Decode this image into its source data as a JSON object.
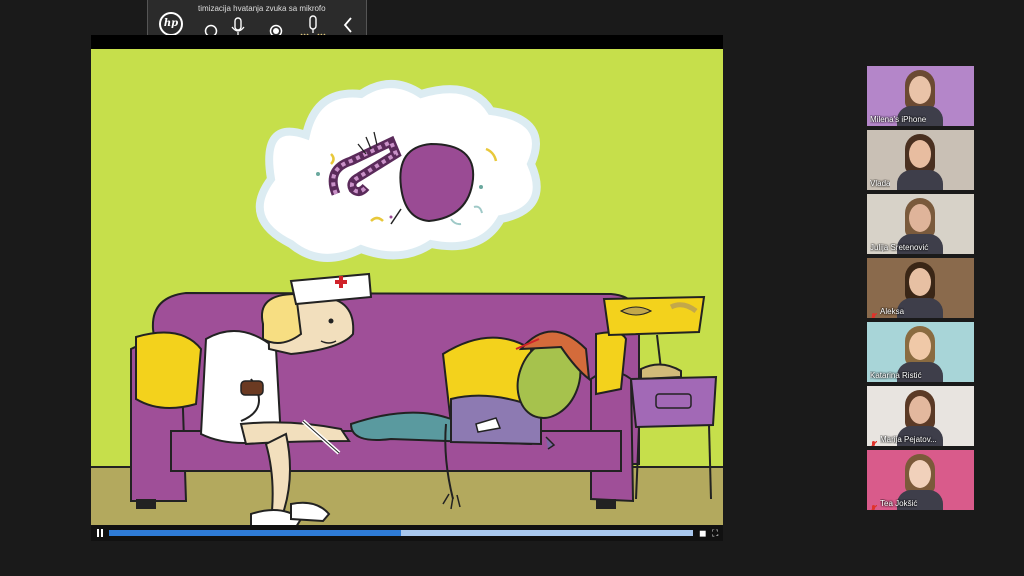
{
  "toolbar": {
    "title": "timizacija hvatanja zvuka sa mikrofo",
    "brand": "hp",
    "icons": [
      "radio-off-icon",
      "mic-icon",
      "radio-on-icon",
      "mic-waves-icon",
      "chevron-left-icon"
    ]
  },
  "player": {
    "progress": 0.5,
    "icons": [
      "pause-icon",
      "volume-icon",
      "fullscreen-icon"
    ],
    "colors": {
      "scene_bg": "#c6df4b",
      "couch": "#9f4f98",
      "pillow": "#f3d21c",
      "seek_fill": "#2e7bd6",
      "seek_track": "#a9c8ee"
    }
  },
  "participants": [
    {
      "name": "Milena's iPhone",
      "muted": false,
      "bg": "#b486c9"
    },
    {
      "name": "Vlada",
      "muted": false,
      "bg": "#c9c0b5"
    },
    {
      "name": "Julija Sretenović",
      "muted": false,
      "bg": "#d7d2c8"
    },
    {
      "name": "Aleksa",
      "muted": true,
      "bg": "#8a6a4c"
    },
    {
      "name": "Katarina Ristić",
      "muted": false,
      "bg": "#a8d5d8"
    },
    {
      "name": "Marija Pejatov...",
      "muted": true,
      "bg": "#e8e4e0"
    },
    {
      "name": "Tea Jokšić",
      "muted": true,
      "bg": "#d95b8b"
    }
  ]
}
